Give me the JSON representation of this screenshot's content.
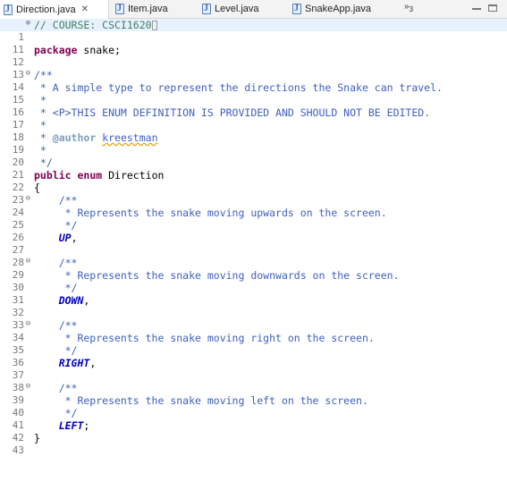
{
  "tabs": [
    {
      "label": "Direction.java",
      "active": true,
      "closable": true
    },
    {
      "label": "Item.java"
    },
    {
      "label": "Level.java"
    },
    {
      "label": "SnakeApp.java"
    }
  ],
  "tab_overflow": {
    "glyph": "»",
    "count": "3"
  },
  "editor": {
    "line_numbers": [
      "1",
      "11",
      "12",
      "13",
      "14",
      "15",
      "16",
      "17",
      "18",
      "19",
      "20",
      "21",
      "22",
      "23",
      "24",
      "25",
      "26",
      "27",
      "28",
      "29",
      "30",
      "31",
      "32",
      "33",
      "34",
      "35",
      "36",
      "37",
      "38",
      "39",
      "40",
      "41",
      "42",
      "43"
    ],
    "lines": {
      "l1_comment": "// COURSE: CSCI1620",
      "l12_kw": "package",
      "l12_rest": " snake;",
      "l14": "/**",
      "l15": " * A simple type to represent the directions the Snake can travel.",
      "l16": " *",
      "l17": " * <P>THIS ENUM DEFINITION IS PROVIDED AND SHOULD NOT BE EDITED.",
      "l18": " *",
      "l19_pre": " * ",
      "l19_tag": "@author",
      "l19_name": "kreestman",
      "l20": " *",
      "l21": " */",
      "l22_kw1": "public",
      "l22_kw2": "enum",
      "l22_name": " Direction",
      "l23": "{",
      "l24": "    /**",
      "l25": "     * Represents the snake moving upwards on the screen.",
      "l26": "     */",
      "l27_const": "UP",
      "l27_rest": ",",
      "l29": "    /**",
      "l30": "     * Represents the snake moving downwards on the screen.",
      "l31": "     */",
      "l32_const": "DOWN",
      "l32_rest": ",",
      "l34": "    /**",
      "l35": "     * Represents the snake moving right on the screen.",
      "l36": "     */",
      "l37_const": "RIGHT",
      "l37_rest": ",",
      "l39": "    /**",
      "l40": "     * Represents the snake moving left on the screen.",
      "l41": "     */",
      "l42_const": "LEFT",
      "l42_rest": ";",
      "l43": "}"
    },
    "colors": {
      "keyword": "#7f0055",
      "comment": "#3f7f5f",
      "javadoc": "#3f5fbf",
      "javadoc_tag": "#7f9fbf",
      "enum_constant": "#0000c0",
      "current_line": "#e8f2fe"
    }
  }
}
